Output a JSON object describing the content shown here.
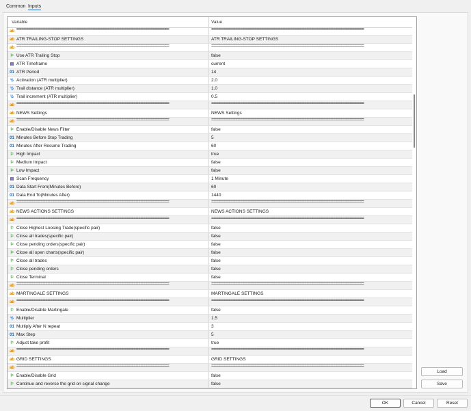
{
  "tabs": {
    "common": "Common",
    "inputs": "Inputs"
  },
  "grid": {
    "col_variable": "Variable",
    "col_value": "Value"
  },
  "rows": [
    {
      "t": "sep",
      "name": "================================================================",
      "value": "================================================================"
    },
    {
      "t": "str",
      "name": "ATR TRAILING-STOP SETTINGS",
      "value": "ATR TRAILING-STOP SETTINGS"
    },
    {
      "t": "sep",
      "name": "================================================================",
      "value": "================================================================"
    },
    {
      "t": "bool",
      "name": "Use ATR Trailing Stop",
      "value": "false"
    },
    {
      "t": "enum",
      "name": "ATR Timeframe",
      "value": "current"
    },
    {
      "t": "int",
      "name": "ATR Period",
      "value": "14"
    },
    {
      "t": "dbl",
      "name": "Activation (ATR multiplier)",
      "value": "2.0"
    },
    {
      "t": "dbl",
      "name": "Trail distance (ATR multiplier)",
      "value": "1.0"
    },
    {
      "t": "dbl",
      "name": "Trail increment (ATR multiplier)",
      "value": "0.5"
    },
    {
      "t": "sep",
      "name": "================================================================",
      "value": "================================================================"
    },
    {
      "t": "str",
      "name": "NEWS Settings",
      "value": "NEWS Settings"
    },
    {
      "t": "sep",
      "name": "================================================================",
      "value": "================================================================"
    },
    {
      "t": "bool",
      "name": "Enable/Disable News Filter",
      "value": "false"
    },
    {
      "t": "int",
      "name": "Minutes Before Stop Trading",
      "value": "5"
    },
    {
      "t": "int",
      "name": "Minutes After Resume Trading",
      "value": "60"
    },
    {
      "t": "bool",
      "name": "High Impact",
      "value": "true"
    },
    {
      "t": "bool",
      "name": "Medium Impact",
      "value": "false"
    },
    {
      "t": "bool",
      "name": "Low Impact",
      "value": "false"
    },
    {
      "t": "enum",
      "name": "Scan Frequency",
      "value": "1 Minute"
    },
    {
      "t": "int",
      "name": "Data Start From(Minutes Before)",
      "value": "60"
    },
    {
      "t": "int",
      "name": "Data End To(Minutes After)",
      "value": "1440"
    },
    {
      "t": "sep",
      "name": "================================================================",
      "value": "================================================================"
    },
    {
      "t": "str",
      "name": "NEWS ACTIONS SETTINGS",
      "value": "NEWS ACTIONS SETTINGS"
    },
    {
      "t": "sep",
      "name": "================================================================",
      "value": "================================================================"
    },
    {
      "t": "bool",
      "name": "Close Highest Loosing Trade(specific pair)",
      "value": "false"
    },
    {
      "t": "bool",
      "name": "Close all trades(specific pair)",
      "value": "false"
    },
    {
      "t": "bool",
      "name": "Close pending orders(specific pair)",
      "value": "false"
    },
    {
      "t": "bool",
      "name": "Close all open charts(specific pair)",
      "value": "false"
    },
    {
      "t": "bool",
      "name": "Close all trades",
      "value": "false"
    },
    {
      "t": "bool",
      "name": "Close pending orders",
      "value": "false"
    },
    {
      "t": "bool",
      "name": "Close Terminal",
      "value": "false"
    },
    {
      "t": "sep",
      "name": "================================================================",
      "value": "================================================================"
    },
    {
      "t": "str",
      "name": "MARTINGALE SETTINGS",
      "value": "MARTINGALE SETTINGS"
    },
    {
      "t": "sep",
      "name": "================================================================",
      "value": "================================================================"
    },
    {
      "t": "bool",
      "name": "Enable/Disable Martingale",
      "value": "false"
    },
    {
      "t": "dbl",
      "name": "Multiplier",
      "value": "1.5"
    },
    {
      "t": "int",
      "name": "Multiply After N repeat",
      "value": "3"
    },
    {
      "t": "int",
      "name": "Max Step",
      "value": "5"
    },
    {
      "t": "bool",
      "name": "Adjust take profit",
      "value": "true"
    },
    {
      "t": "sep",
      "name": "================================================================",
      "value": "================================================================"
    },
    {
      "t": "str",
      "name": "GRID SETTINGS",
      "value": "GRID SETTINGS"
    },
    {
      "t": "sep",
      "name": "================================================================",
      "value": "================================================================"
    },
    {
      "t": "bool",
      "name": "Enable/Disable Grid",
      "value": "false"
    },
    {
      "t": "bool",
      "name": "Continue and reverse the grid on signal change",
      "value": "false"
    }
  ],
  "icons": {
    "sep": {
      "glyph": "ab",
      "name": "string-type-icon"
    },
    "str": {
      "glyph": "ab",
      "name": "string-type-icon"
    },
    "bool": {
      "glyph": "⚐",
      "name": "boolean-flag-icon"
    },
    "enum": {
      "glyph": "▤",
      "name": "enum-list-icon"
    },
    "int": {
      "glyph": "01",
      "name": "integer-type-icon"
    },
    "dbl": {
      "glyph": "½",
      "name": "double-type-icon"
    }
  },
  "buttons": {
    "load": "Load",
    "save": "Save",
    "ok": "OK",
    "cancel": "Cancel",
    "reset": "Reset"
  },
  "colors": {
    "accent": "#1a5fb4",
    "string_icon": "#d08000",
    "bool_icon": "#1e9e1e"
  }
}
